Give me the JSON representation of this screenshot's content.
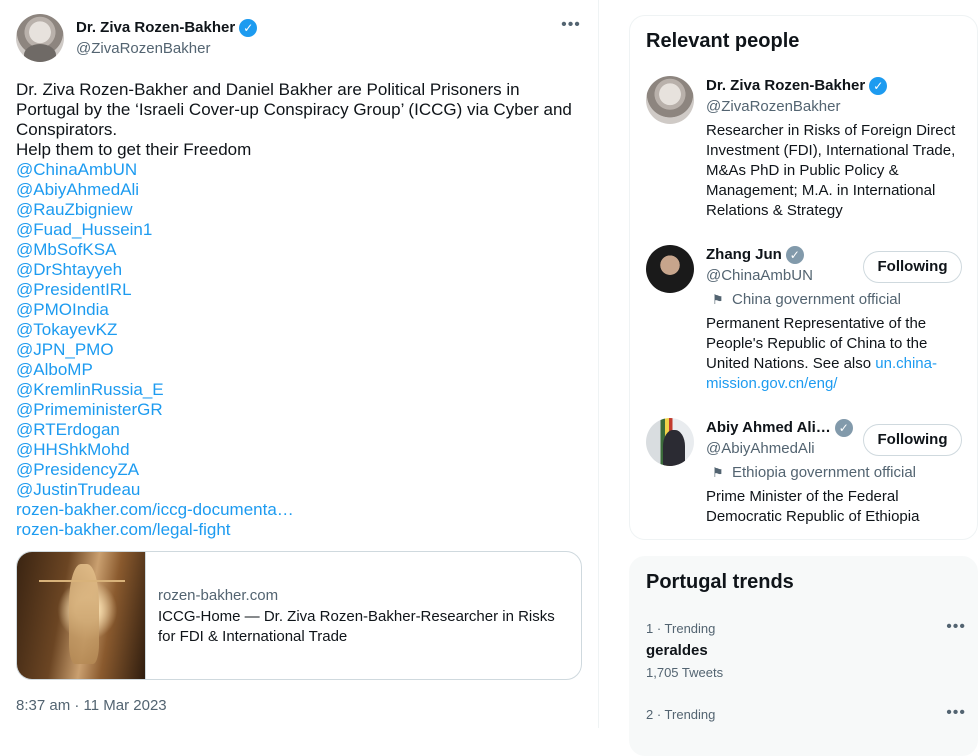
{
  "tweet": {
    "author_name": "Dr. Ziva Rozen-Bakher",
    "author_handle": "@ZivaRozenBakher",
    "more_icon": "more-horizontal-icon",
    "text_lines": [
      "Dr. Ziva Rozen-Bakher and Daniel Bakher are Political Prisoners in",
      "Portugal by the ‘Israeli Cover-up Conspiracy Group’ (ICCG) via Cyber and",
      "Conspirators.",
      "Help them to get their Freedom"
    ],
    "mentions": [
      "@ChinaAmbUN",
      "@AbiyAhmedAli",
      "@RauZbigniew",
      "@Fuad_Hussein1",
      "@MbSofKSA",
      "@DrShtayyeh",
      "@PresidentIRL",
      "@PMOIndia",
      "@TokayevKZ",
      "@JPN_PMO",
      "@AlboMP",
      "@KremlinRussia_E",
      "@PrimeministerGR",
      "@RTErdogan",
      "@HHShkMohd",
      "@PresidencyZA",
      "@JustinTrudeau"
    ],
    "links": [
      "rozen-bakher.com/iccg-documenta…",
      "rozen-bakher.com/legal-fight"
    ],
    "card": {
      "domain": "rozen-bakher.com",
      "title": "ICCG-Home — Dr. Ziva Rozen-Bakher-Researcher in Risks for FDI & International Trade"
    },
    "timestamp": "8:37 am · 11 Mar 2023"
  },
  "relevant_people": {
    "title": "Relevant people",
    "people": [
      {
        "name": "Dr. Ziva Rozen-Bakher",
        "handle": "@ZivaRozenBakher",
        "verified": "blue",
        "bio": "Researcher in Risks of Foreign Direct Investment (FDI), International Trade, M&As PhD in Public Policy & Management; M.A. in International Relations & Strategy"
      },
      {
        "name": "Zhang Jun",
        "handle": "@ChinaAmbUN",
        "verified": "gray",
        "badge": "China government official",
        "bio": "Permanent Representative of the People's Republic of China to the United Nations. See also ",
        "bio_link": "un.china-mission.gov.cn/eng/",
        "button": "Following"
      },
      {
        "name": "Abiy Ahmed Ali…",
        "handle": "@AbiyAhmedAli",
        "verified": "gray",
        "badge": "Ethiopia government official",
        "bio": "Prime Minister of the Federal Democratic Republic of Ethiopia",
        "button": "Following"
      }
    ]
  },
  "trends": {
    "title": "Portugal trends",
    "items": [
      {
        "meta": "1 · Trending",
        "name": "geraldes",
        "count": "1,705 Tweets"
      },
      {
        "meta": "2 · Trending"
      }
    ]
  },
  "colors": {
    "link": "#1d9bf0",
    "text": "#0f1419",
    "secondary": "#536471",
    "verified_blue": "#1d9bf0",
    "verified_gray": "#829aab"
  }
}
